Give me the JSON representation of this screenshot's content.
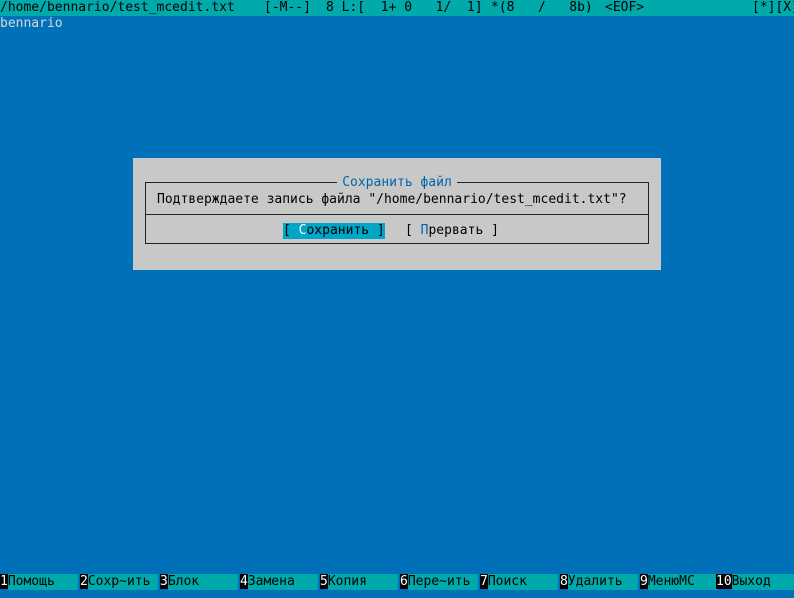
{
  "status": {
    "filepath": "/home/bennario/test_mcedit.txt",
    "mode": "[-M--]",
    "position": "8 L:[  1+ 0   1/  1]",
    "char_info": "*(8   /   8b)",
    "eof": "<EOF>",
    "window_controls": "[*][X]"
  },
  "editor": {
    "line1": "bennario"
  },
  "dialog": {
    "title": "Сохранить файл",
    "message": "Подтверждаете запись файла \"/home/bennario/test_mcedit.txt\"?",
    "save_open": "[ ",
    "save_hot": "С",
    "save_rest": "охранить ]",
    "abort_open": "[ ",
    "abort_hot": "П",
    "abort_rest": "рервать ]"
  },
  "keybar": [
    {
      "num": "1",
      "label": "Помощь"
    },
    {
      "num": "2",
      "label": "Сохр~ить"
    },
    {
      "num": "3",
      "label": "Блок"
    },
    {
      "num": "4",
      "label": "Замена"
    },
    {
      "num": "5",
      "label": "Копия"
    },
    {
      "num": "6",
      "label": "Пере~ить"
    },
    {
      "num": "7",
      "label": "Поиск"
    },
    {
      "num": "8",
      "label": "Удалить"
    },
    {
      "num": "9",
      "label": "МенюMC"
    },
    {
      "num": "10",
      "label": "Выход"
    }
  ]
}
